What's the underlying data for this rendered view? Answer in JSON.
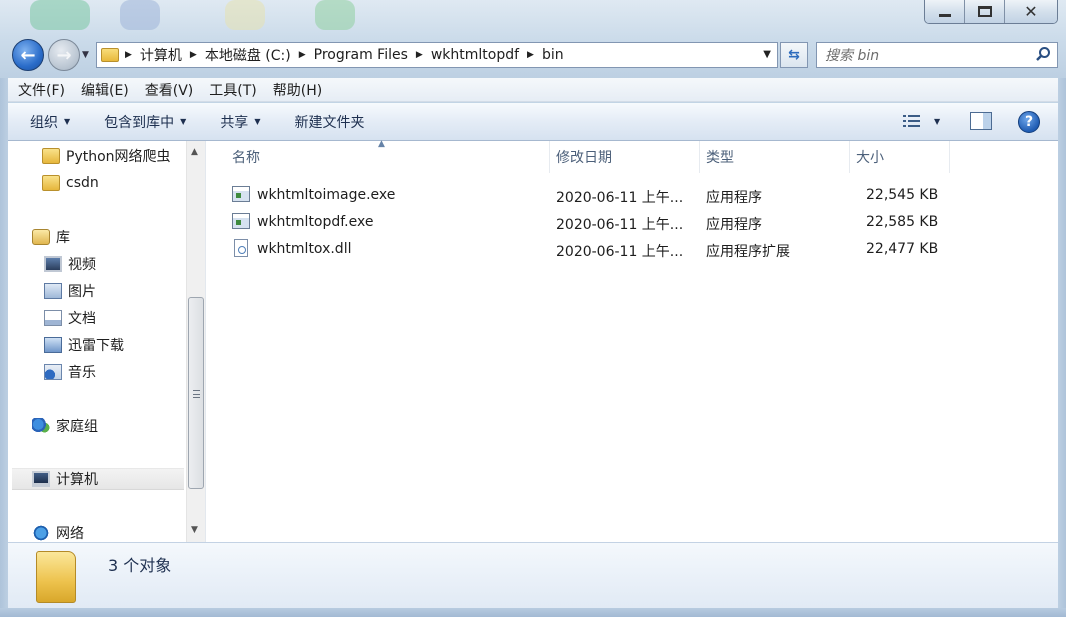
{
  "address": {
    "crumbs": [
      "计算机",
      "本地磁盘 (C:)",
      "Program Files",
      "wkhtmltopdf",
      "bin"
    ]
  },
  "search": {
    "placeholder": "搜索 bin"
  },
  "menu": [
    "文件(F)",
    "编辑(E)",
    "查看(V)",
    "工具(T)",
    "帮助(H)"
  ],
  "commands": {
    "organize": "组织",
    "include_in_library": "包含到库中",
    "share": "共享",
    "new_folder": "新建文件夹"
  },
  "nav": {
    "folder1": "Python网络爬虫",
    "folder2": "csdn",
    "libraries": "库",
    "videos": "视频",
    "pictures": "图片",
    "documents": "文档",
    "xunlei": "迅雷下载",
    "music": "音乐",
    "homegroup": "家庭组",
    "computer": "计算机",
    "network": "网络"
  },
  "columns": {
    "name": "名称",
    "date": "修改日期",
    "type": "类型",
    "size": "大小"
  },
  "files": [
    {
      "name": "wkhtmltoimage.exe",
      "date": "2020-06-11 上午...",
      "type": "应用程序",
      "size": "22,545 KB",
      "icon": "exe-icon"
    },
    {
      "name": "wkhtmltopdf.exe",
      "date": "2020-06-11 上午...",
      "type": "应用程序",
      "size": "22,585 KB",
      "icon": "exe-icon"
    },
    {
      "name": "wkhtmltox.dll",
      "date": "2020-06-11 上午...",
      "type": "应用程序扩展",
      "size": "22,477 KB",
      "icon": "dll-icon"
    }
  ],
  "details": {
    "count": "3 个对象"
  }
}
